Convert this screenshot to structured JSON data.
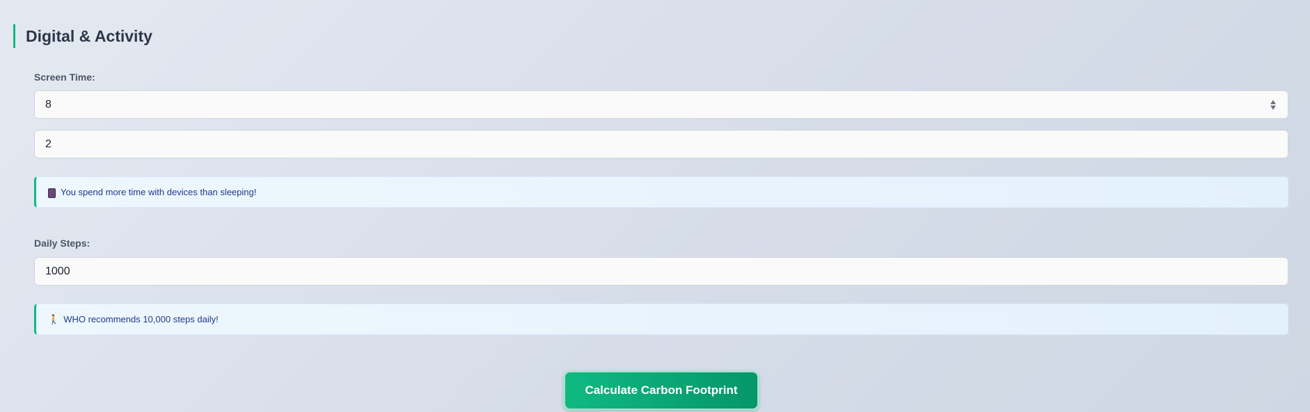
{
  "section": {
    "title": "Digital & Activity",
    "accent_color": "#10b981"
  },
  "screen_time": {
    "label": "Screen Time:",
    "selected_value": "8",
    "second_value": "2",
    "tip_icon": "mobile-phone-icon",
    "tip_text": "You spend more time with devices than sleeping!"
  },
  "daily_steps": {
    "label": "Daily Steps:",
    "value": "1000",
    "tip_icon": "person-walking-icon",
    "tip_text": "WHO recommends 10,000 steps daily!"
  },
  "actions": {
    "calculate_label": "Calculate Carbon Footprint",
    "button_color": "#10b981"
  }
}
